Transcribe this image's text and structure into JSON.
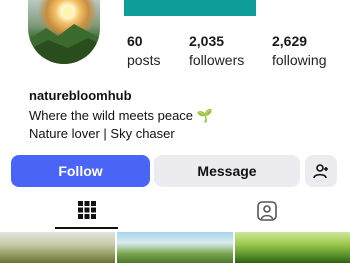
{
  "profile": {
    "username": "naturebloomhub",
    "bio_line1": "Where the wild meets peace",
    "bio_emoji": "🌱",
    "bio_line2": "Nature lover | Sky chaser"
  },
  "stats": {
    "posts": {
      "value": "60",
      "label": "posts"
    },
    "followers": {
      "value": "2,035",
      "label": "followers"
    },
    "following": {
      "value": "2,629",
      "label": "following"
    }
  },
  "actions": {
    "follow_label": "Follow",
    "message_label": "Message",
    "add_user_icon": "add-user-icon"
  },
  "tabs": [
    {
      "icon": "grid-icon",
      "selected": true
    },
    {
      "icon": "tagged-person-icon",
      "selected": false
    }
  ],
  "colors": {
    "follow_button": "#4a65f5",
    "secondary_button": "#ececf0",
    "banner": "#0f9d9a"
  }
}
